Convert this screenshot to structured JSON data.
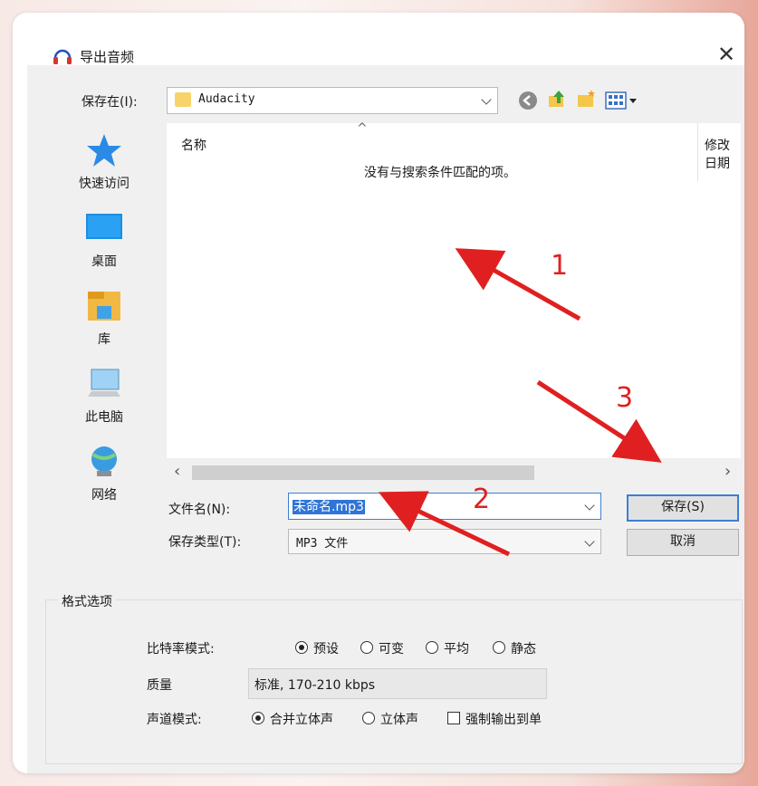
{
  "dialog": {
    "title": "导出音频",
    "save_in_label": "保存在(I):",
    "location": "Audacity"
  },
  "sidebar": {
    "items": [
      {
        "label": "快速访问",
        "icon": "star-icon"
      },
      {
        "label": "桌面",
        "icon": "desktop-icon"
      },
      {
        "label": "库",
        "icon": "library-icon"
      },
      {
        "label": "此电脑",
        "icon": "computer-icon"
      },
      {
        "label": "网络",
        "icon": "network-icon"
      }
    ]
  },
  "filelist": {
    "col_name": "名称",
    "col_modified": "修改日期",
    "empty_message": "没有与搜索条件匹配的项。"
  },
  "form": {
    "filename_label": "文件名(N):",
    "filename_value": "未命名.mp3",
    "filetype_label": "保存类型(T):",
    "filetype_value": "MP3 文件",
    "save_button": "保存(S)",
    "cancel_button": "取消"
  },
  "options": {
    "group_title": "格式选项",
    "bitrate_label": "比特率模式:",
    "bitrate_modes": [
      "预设",
      "可变",
      "平均",
      "静态"
    ],
    "bitrate_selected": "预设",
    "quality_label": "质量",
    "quality_value": "标准, 170-210 kbps",
    "channel_label": "声道模式:",
    "channel_modes": [
      "合并立体声",
      "立体声"
    ],
    "channel_selected": "合并立体声",
    "force_mono_label": "强制输出到单"
  },
  "annotations": {
    "labels": [
      "1",
      "2",
      "3"
    ],
    "color": "#e02020"
  },
  "colors": {
    "selection": "#2f74d6",
    "default_button_border": "#3c7fd4"
  }
}
